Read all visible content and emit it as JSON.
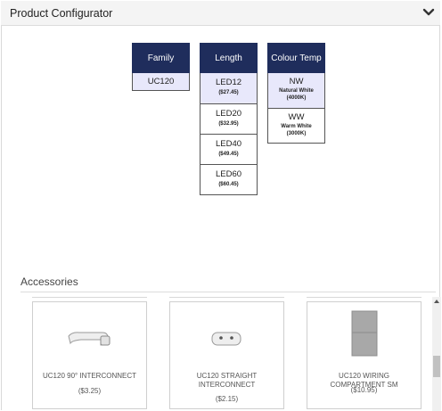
{
  "header": {
    "title": "Product Configurator",
    "toggle_icon": "chevron-down-icon"
  },
  "configurator": {
    "columns": [
      {
        "key": "family",
        "title": "Family",
        "options": [
          {
            "label": "UC120",
            "selected": true
          }
        ]
      },
      {
        "key": "length",
        "title": "Length",
        "options": [
          {
            "label": "LED12",
            "price": "($27.45)",
            "selected": true
          },
          {
            "label": "LED20",
            "price": "($32.95)",
            "selected": false
          },
          {
            "label": "LED40",
            "price": "($49.45)",
            "selected": false
          },
          {
            "label": "LED60",
            "price": "($60.45)",
            "selected": false
          }
        ]
      },
      {
        "key": "colour_temp",
        "title": "Colour Temp",
        "options": [
          {
            "label": "NW",
            "desc": "Natural White",
            "kelvin": "(4000K)",
            "selected": true
          },
          {
            "label": "WW",
            "desc": "Warm White",
            "kelvin": "(3000K)",
            "selected": false
          }
        ]
      }
    ]
  },
  "accessories": {
    "title": "Accessories",
    "items": [
      {
        "name": "UC120 90° INTERCONNECT",
        "price": "($3.25)",
        "icon": "interconnect-90-image"
      },
      {
        "name": "UC120 STRAIGHT INTERCONNECT",
        "price": "($2.15)",
        "icon": "straight-interconnect-image"
      },
      {
        "name": "UC120 WIRING COMPARTMENT SM",
        "price": "($10.95)",
        "icon": "wiring-compartment-image"
      }
    ]
  },
  "colors": {
    "column_header": "#1f2d5c",
    "selected_option": "#e8e8fb",
    "header_bar": "#f4f4f4"
  }
}
